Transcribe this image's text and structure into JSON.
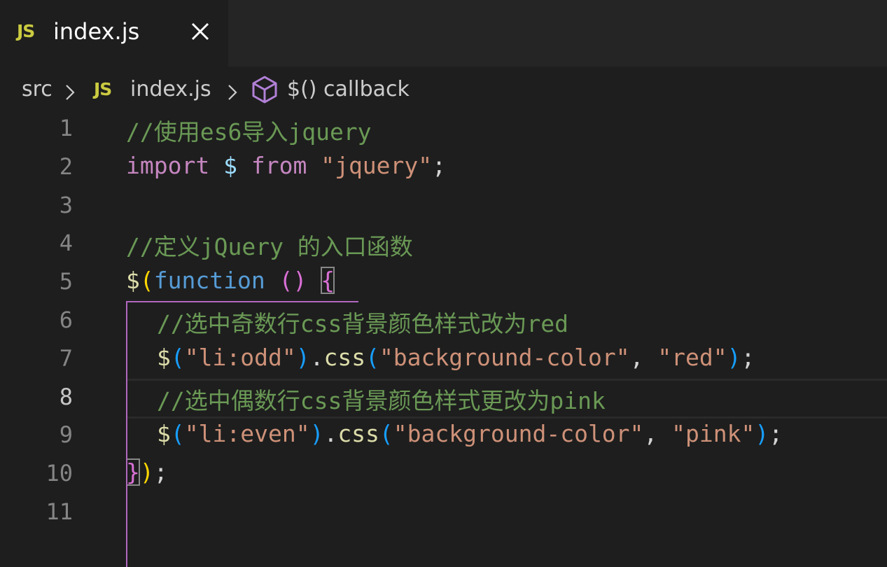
{
  "tab": {
    "badge": "JS",
    "title": "index.js"
  },
  "breadcrumb": {
    "folder": "src",
    "badge": "JS",
    "file": "index.js",
    "symbol": "$() callback"
  },
  "editor": {
    "current_line": 8,
    "lines": [
      {
        "n": "1",
        "tokens": [
          {
            "t": "//使用es6导入jquery",
            "k": "comment"
          }
        ]
      },
      {
        "n": "2",
        "tokens": [
          {
            "t": "import",
            "k": "kw"
          },
          {
            "t": " ",
            "k": "plain"
          },
          {
            "t": "$",
            "k": "var"
          },
          {
            "t": " ",
            "k": "plain"
          },
          {
            "t": "from",
            "k": "kw"
          },
          {
            "t": " ",
            "k": "plain"
          },
          {
            "t": "\"jquery\"",
            "k": "str"
          },
          {
            "t": ";",
            "k": "plain"
          }
        ]
      },
      {
        "n": "3",
        "tokens": []
      },
      {
        "n": "4",
        "tokens": [
          {
            "t": "//定义jQuery 的入口函数",
            "k": "comment"
          }
        ]
      },
      {
        "n": "5",
        "tokens": [
          {
            "t": "$",
            "k": "fn"
          },
          {
            "t": "(",
            "k": "b1"
          },
          {
            "t": "function",
            "k": "decl"
          },
          {
            "t": " ",
            "k": "plain"
          },
          {
            "t": "()",
            "k": "b2"
          },
          {
            "t": " ",
            "k": "plain"
          },
          {
            "t": "{",
            "k": "b2",
            "box": true
          }
        ]
      },
      {
        "n": "6",
        "indent": true,
        "tokens": [
          {
            "t": "//选中奇数行css背景颜色样式改为red",
            "k": "comment"
          }
        ]
      },
      {
        "n": "7",
        "indent": true,
        "tokens": [
          {
            "t": "$",
            "k": "fn"
          },
          {
            "t": "(",
            "k": "b3"
          },
          {
            "t": "\"li:odd\"",
            "k": "str"
          },
          {
            "t": ")",
            "k": "b3"
          },
          {
            "t": ".",
            "k": "plain"
          },
          {
            "t": "css",
            "k": "fn"
          },
          {
            "t": "(",
            "k": "b3"
          },
          {
            "t": "\"background-color\"",
            "k": "str"
          },
          {
            "t": ", ",
            "k": "plain"
          },
          {
            "t": "\"red\"",
            "k": "str"
          },
          {
            "t": ")",
            "k": "b3"
          },
          {
            "t": ";",
            "k": "plain"
          }
        ]
      },
      {
        "n": "8",
        "indent": true,
        "tokens": [
          {
            "t": "//选中偶数行css背景颜色样式更改为pink",
            "k": "comment"
          }
        ]
      },
      {
        "n": "9",
        "indent": true,
        "tokens": [
          {
            "t": "$",
            "k": "fn"
          },
          {
            "t": "(",
            "k": "b3"
          },
          {
            "t": "\"li:even\"",
            "k": "str"
          },
          {
            "t": ")",
            "k": "b3"
          },
          {
            "t": ".",
            "k": "plain"
          },
          {
            "t": "css",
            "k": "fn"
          },
          {
            "t": "(",
            "k": "b3"
          },
          {
            "t": "\"background-color\"",
            "k": "str"
          },
          {
            "t": ", ",
            "k": "plain"
          },
          {
            "t": "\"pink\"",
            "k": "str"
          },
          {
            "t": ")",
            "k": "b3"
          },
          {
            "t": ";",
            "k": "plain"
          }
        ]
      },
      {
        "n": "10",
        "tokens": [
          {
            "t": "}",
            "k": "b2",
            "box": true
          },
          {
            "t": ")",
            "k": "b1"
          },
          {
            "t": ";",
            "k": "plain"
          }
        ]
      },
      {
        "n": "11",
        "tokens": []
      }
    ]
  },
  "colors": {
    "background": "#1e1e1e",
    "tabbar": "#252526",
    "comment": "#6a9955",
    "keyword": "#c586c0",
    "string": "#ce9178",
    "function": "#dcdcaa",
    "bracket_guide": "#b267c0"
  }
}
